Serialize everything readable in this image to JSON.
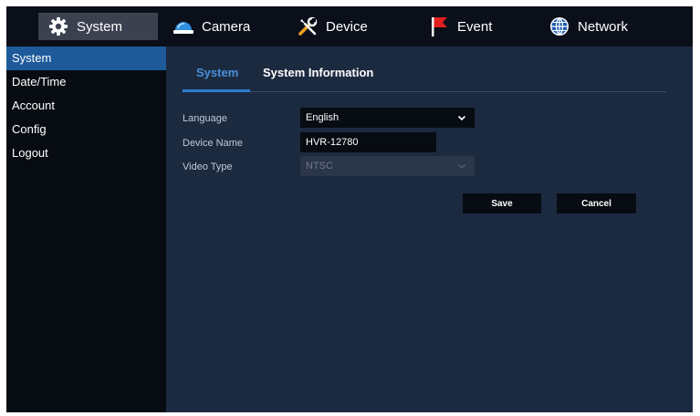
{
  "topnav": {
    "items": [
      {
        "label": "System",
        "icon": "gear-icon",
        "active": true
      },
      {
        "label": "Camera",
        "icon": "camera-dome-icon"
      },
      {
        "label": "Device",
        "icon": "tools-icon"
      },
      {
        "label": "Event",
        "icon": "flag-icon"
      },
      {
        "label": "Network",
        "icon": "globe-icon"
      }
    ]
  },
  "sidebar": {
    "items": [
      {
        "label": "System",
        "active": true
      },
      {
        "label": "Date/Time"
      },
      {
        "label": "Account"
      },
      {
        "label": "Config"
      },
      {
        "label": "Logout"
      }
    ]
  },
  "tabs": [
    {
      "label": "System",
      "active": true
    },
    {
      "label": "System Information"
    }
  ],
  "form": {
    "language": {
      "label": "Language",
      "value": "English"
    },
    "device_name": {
      "label": "Device Name",
      "value": "HVR-12780"
    },
    "video_type": {
      "label": "Video Type",
      "value": "NTSC",
      "disabled": true
    }
  },
  "buttons": {
    "save": "Save",
    "cancel": "Cancel"
  },
  "colors": {
    "accent": "#2f7fd0",
    "sidebar_active": "#1e5a9a",
    "panel": "#1c2a40",
    "nav_active": "#3c4150",
    "flag": "#e02020"
  }
}
